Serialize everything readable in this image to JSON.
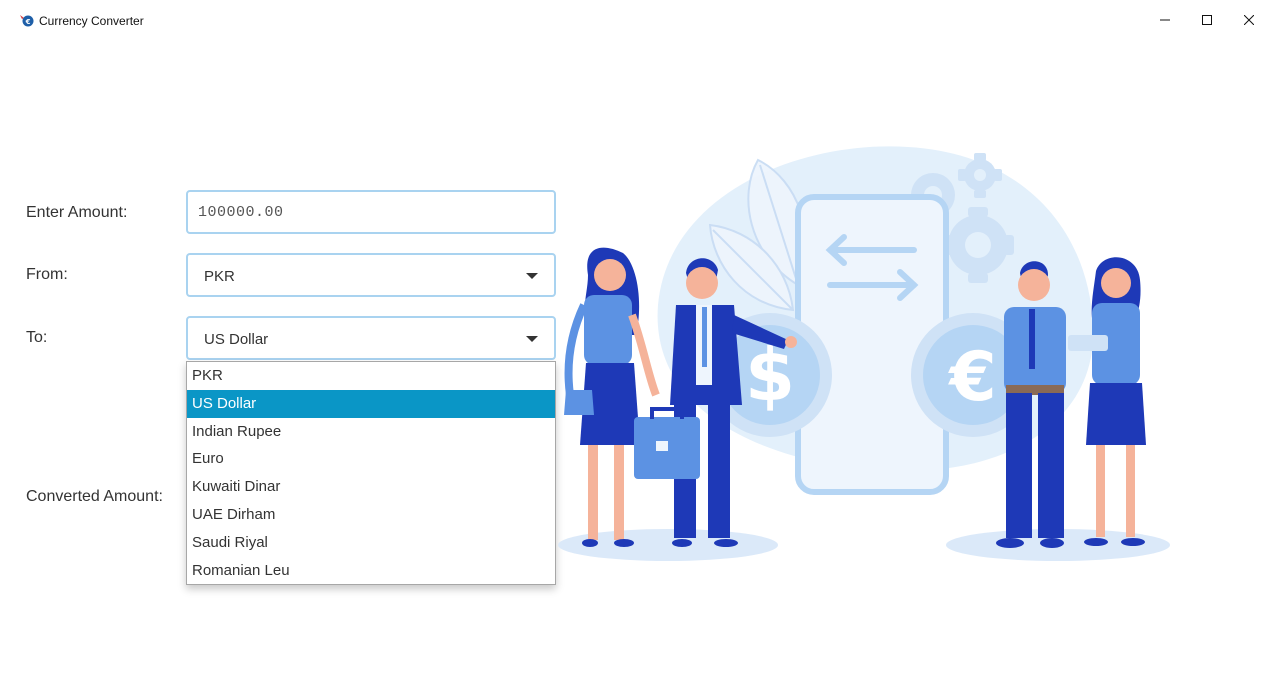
{
  "window": {
    "title": "Currency Converter",
    "controls": {
      "minimize": "minimize",
      "maximize": "maximize",
      "close": "close"
    }
  },
  "form": {
    "amount_label": "Enter Amount:",
    "amount_value": "100000.00",
    "from_label": "From:",
    "from_value": "PKR",
    "to_label": "To:",
    "to_value": "US Dollar",
    "converted_label": "Converted Amount:"
  },
  "dropdown": {
    "options": [
      "PKR",
      "US Dollar",
      "Indian Rupee",
      "Euro",
      "Kuwaiti Dinar",
      "UAE Dirham",
      "Saudi Riyal",
      "Romanian Leu"
    ],
    "selected_index": 1
  },
  "illustration": {
    "icons": [
      "dollar-coin-icon",
      "euro-coin-icon",
      "exchange-arrows-icon",
      "gear-icon",
      "leaf-icon"
    ],
    "coin_symbols": {
      "dollar": "$",
      "euro": "€"
    }
  },
  "colors": {
    "accent": "#0a96c6",
    "field_border": "#a9d3f0",
    "illustration_light": "#e3f0fb",
    "illustration_mid": "#b5d5f4",
    "illustration_dark": "#1e39b7"
  }
}
